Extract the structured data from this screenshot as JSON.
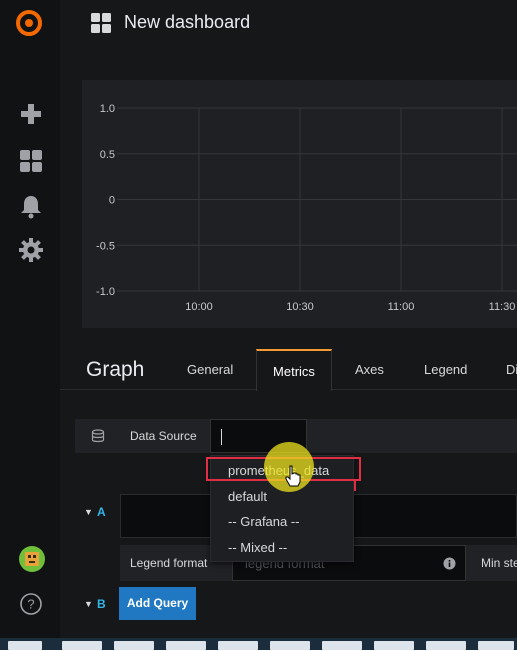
{
  "header": {
    "title": "New dashboard"
  },
  "graph": {
    "y_ticks": [
      "1.0",
      "0.5",
      "0",
      "-0.5",
      "-1.0"
    ],
    "x_ticks": [
      "10:00",
      "10:30",
      "11:00",
      "11:30"
    ]
  },
  "editor": {
    "title": "Graph",
    "tabs": [
      "General",
      "Metrics",
      "Axes",
      "Legend",
      "Di"
    ],
    "active_tab": "Metrics"
  },
  "data_source": {
    "label": "Data Source",
    "value": ""
  },
  "dropdown": {
    "options": [
      "prometheus_data",
      "default",
      "-- Grafana --",
      "-- Mixed --"
    ]
  },
  "query_rows": [
    "A",
    "B"
  ],
  "legend": {
    "label": "Legend format",
    "placeholder": "legend format",
    "min_step_label": "Min ste"
  },
  "actions": {
    "add_query": "Add Query"
  },
  "colors": {
    "accent": "#1f78c1",
    "highlight": "#e02f44",
    "tab_active_border": "#f29b34",
    "row_letter": "#33b5e5"
  },
  "sidebar": {
    "icons": [
      "grafana-logo-icon",
      "plus-icon",
      "dashboards-icon",
      "bell-icon",
      "gear-icon",
      "avatar",
      "help-icon"
    ]
  }
}
